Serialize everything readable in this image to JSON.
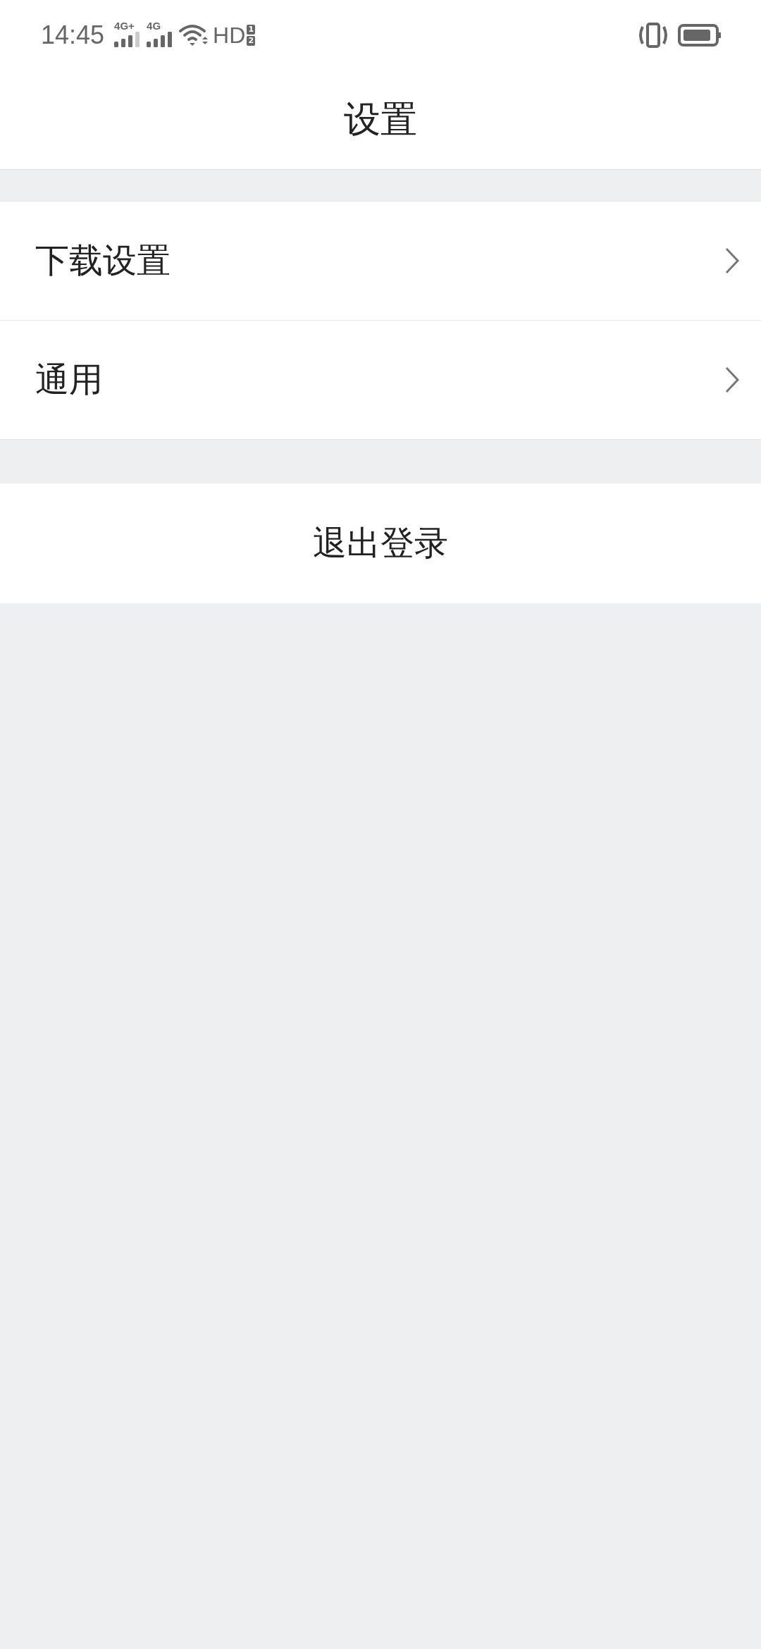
{
  "status_bar": {
    "time": "14:45",
    "sim1": "4G+",
    "sim2": "4G",
    "hd": "HD",
    "hd_sims": [
      "1",
      "2"
    ]
  },
  "header": {
    "title": "设置"
  },
  "menu_items": [
    {
      "label": "下载设置"
    },
    {
      "label": "通用"
    }
  ],
  "logout_button": {
    "label": "退出登录"
  }
}
